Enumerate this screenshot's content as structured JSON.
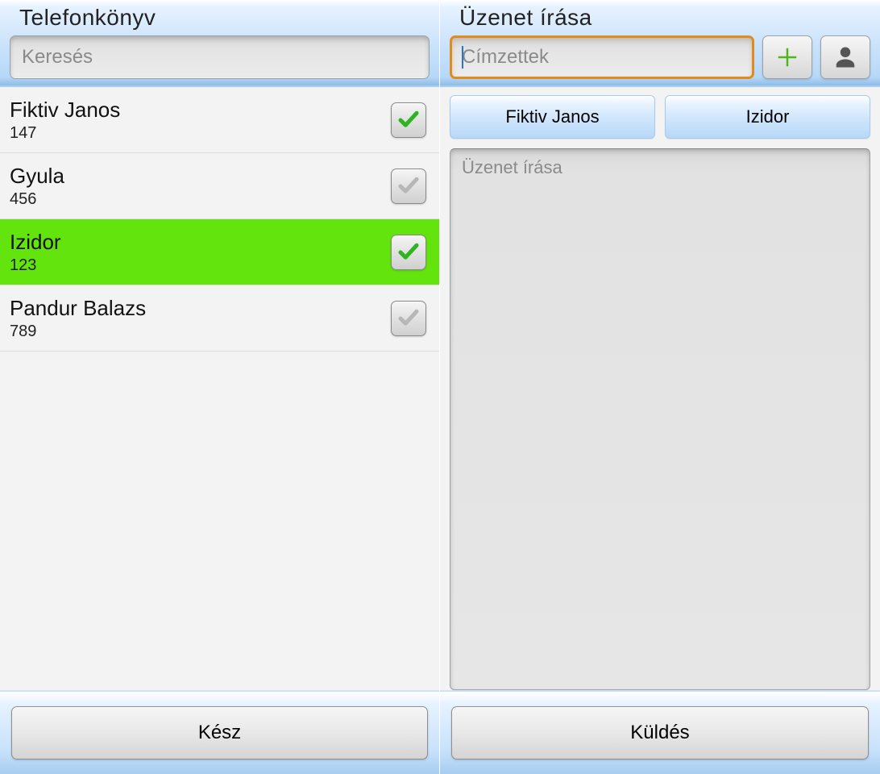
{
  "left": {
    "title": "Telefonkönyv",
    "search_placeholder": "Keresés",
    "contacts": [
      {
        "name": "Fiktiv  Janos",
        "number": "147",
        "checked": true,
        "highlighted": false
      },
      {
        "name": "Gyula",
        "number": "456",
        "checked": false,
        "highlighted": false
      },
      {
        "name": "Izidor",
        "number": "123",
        "checked": true,
        "highlighted": true
      },
      {
        "name": "Pandur  Balazs",
        "number": "789",
        "checked": false,
        "highlighted": false
      }
    ],
    "done_label": "Kész"
  },
  "right": {
    "title": "Üzenet írása",
    "recipients_placeholder": "Címzettek",
    "recipients_focused": true,
    "add_icon": "plus-icon",
    "pick_icon": "person-icon",
    "recipient_chips": [
      {
        "label": "Fiktiv  Janos"
      },
      {
        "label": "Izidor"
      }
    ],
    "message_placeholder": "Üzenet írása",
    "send_label": "Küldés"
  },
  "colors": {
    "chip_blue_top": "#e6f2ff",
    "chip_blue_bottom": "#b7d8f8",
    "highlight_green": "#62e40c",
    "check_green": "#2fb421",
    "focus_orange": "#e28b1d"
  }
}
